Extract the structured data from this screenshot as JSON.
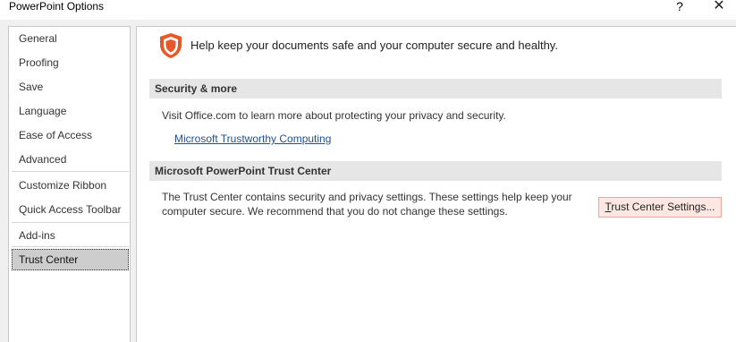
{
  "window": {
    "title": "PowerPoint Options",
    "help_label": "?",
    "close_label": "✕"
  },
  "sidebar": {
    "items": [
      {
        "label": "General"
      },
      {
        "label": "Proofing"
      },
      {
        "label": "Save"
      },
      {
        "label": "Language"
      },
      {
        "label": "Ease of Access"
      },
      {
        "label": "Advanced"
      },
      {
        "label": "Customize Ribbon"
      },
      {
        "label": "Quick Access Toolbar"
      },
      {
        "label": "Add-ins"
      },
      {
        "label": "Trust Center"
      }
    ],
    "selected": "Trust Center"
  },
  "main": {
    "headline": "Help keep your documents safe and your computer secure and healthy.",
    "shield_icon": "shield-icon",
    "shield_color": "#e8572a",
    "sections": [
      {
        "header": "Security & more",
        "text": "Visit Office.com to learn more about protecting your privacy and security.",
        "link": "Microsoft Trustworthy Computing"
      },
      {
        "header": "Microsoft PowerPoint Trust Center",
        "text_line1": "The Trust Center contains security and privacy settings. These settings help keep your",
        "text_line2": "computer secure. We recommend that you do not change these settings.",
        "button_label_first": "T",
        "button_label_rest": "rust Center Settings..."
      }
    ]
  }
}
